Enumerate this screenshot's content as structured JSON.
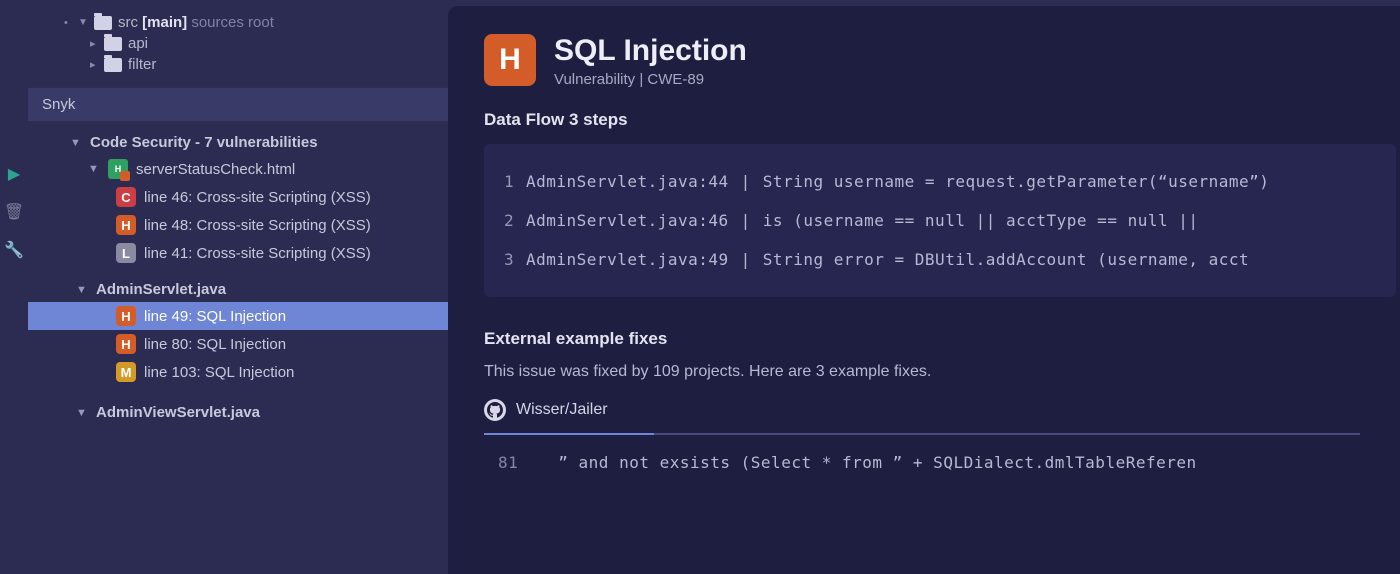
{
  "fileTree": {
    "root": {
      "name": "src",
      "branch": "[main]",
      "tag": "sources root"
    },
    "children": [
      {
        "name": "api"
      },
      {
        "name": "filter"
      }
    ]
  },
  "panelTitle": "Snyk",
  "codeSecurity": {
    "header": "Code Security - 7 vulnerabilities",
    "groups": [
      {
        "file": "serverStatusCheck.html",
        "items": [
          {
            "badge": "C",
            "text": "line 46: Cross-site Scripting (XSS)"
          },
          {
            "badge": "H",
            "text": "line 48: Cross-site Scripting (XSS)"
          },
          {
            "badge": "L",
            "text": "line 41: Cross-site Scripting (XSS)"
          }
        ]
      },
      {
        "file": "AdminServlet.java",
        "items": [
          {
            "badge": "H",
            "text": "line 49: SQL Injection",
            "selected": true
          },
          {
            "badge": "H",
            "text": "line 80: SQL Injection"
          },
          {
            "badge": "M",
            "text": "line 103: SQL Injection"
          }
        ]
      },
      {
        "file": "AdminViewServlet.java",
        "items": []
      }
    ]
  },
  "detail": {
    "badge": "H",
    "title": "SQL Injection",
    "subtitle": "Vulnerability | CWE-89",
    "dataFlowLabel": "Data Flow 3 steps",
    "flow": [
      {
        "n": "1",
        "loc": "AdminServlet.java:44",
        "code": "String username = request.getParameter(“username”)"
      },
      {
        "n": "2",
        "loc": "AdminServlet.java:46",
        "code": "is (username == null || acctType == null ||"
      },
      {
        "n": "3",
        "loc": "AdminServlet.java:49",
        "code": "String error = DBUtil.addAccount (username, acct"
      }
    ],
    "externalHeader": "External example fixes",
    "externalDesc": "This issue was fixed by 109 projects. Here are 3 example fixes.",
    "fixSource": "Wisser/Jailer",
    "diffLine": {
      "lineno": "81",
      "code": "” and not exsists (Select * from ” + SQLDialect.dmlTableReferen"
    }
  }
}
